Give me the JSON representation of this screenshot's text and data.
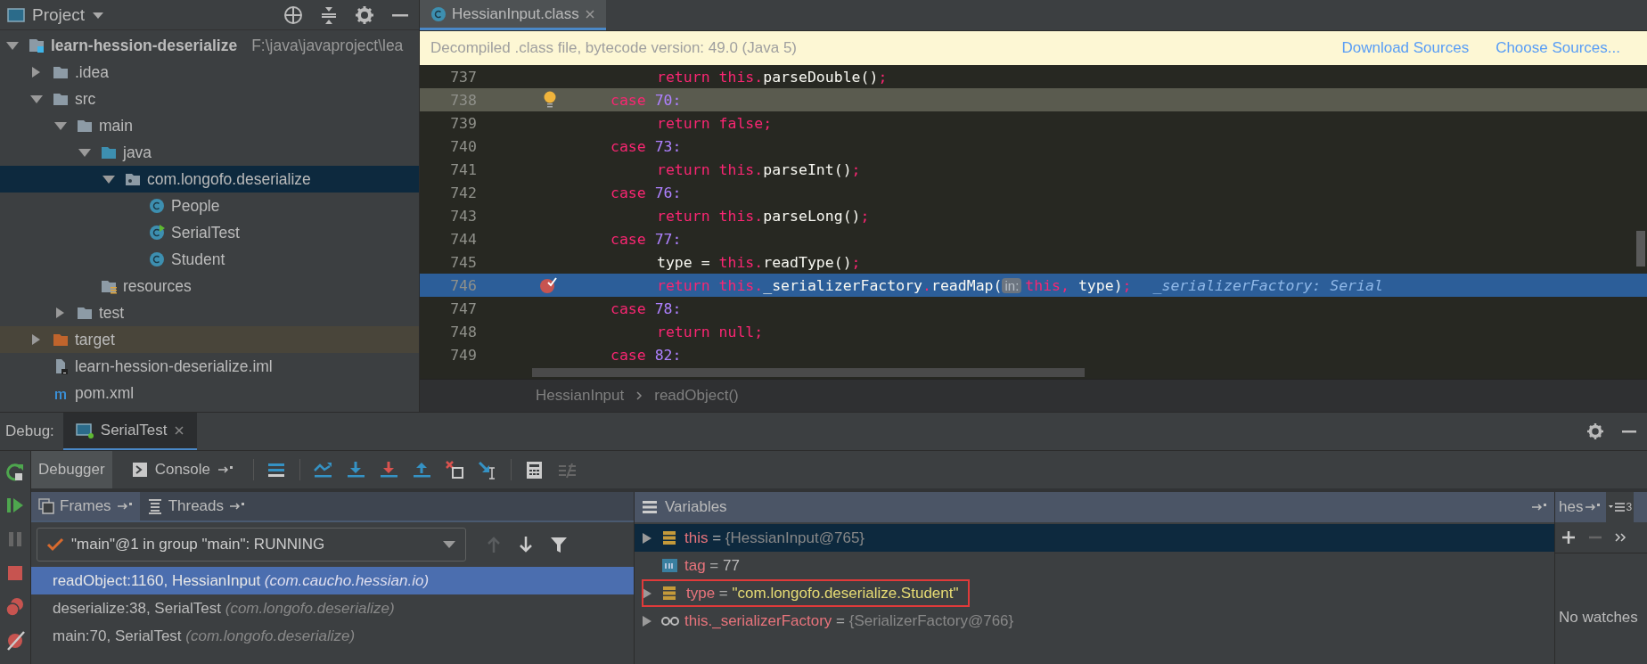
{
  "project_panel": {
    "title": "Project",
    "tree": [
      {
        "name": "learn-hession-deserialize",
        "path": "F:\\java\\javaproject\\lea",
        "kind": "module",
        "expanded": true,
        "selected": false,
        "children": [
          {
            "name": ".idea",
            "kind": "folder",
            "expanded": false,
            "selected": false
          },
          {
            "name": "src",
            "kind": "folder",
            "expanded": true,
            "selected": false,
            "children": [
              {
                "name": "main",
                "kind": "folder",
                "expanded": true,
                "selected": false,
                "children": [
                  {
                    "name": "java",
                    "kind": "source",
                    "expanded": true,
                    "selected": false,
                    "children": [
                      {
                        "name": "com.longofo.deserialize",
                        "kind": "package",
                        "expanded": true,
                        "selected": true,
                        "children": [
                          {
                            "name": "People",
                            "kind": "class",
                            "selected": false
                          },
                          {
                            "name": "SerialTest",
                            "kind": "runnable",
                            "selected": false
                          },
                          {
                            "name": "Student",
                            "kind": "class",
                            "selected": false
                          }
                        ]
                      }
                    ]
                  },
                  {
                    "name": "resources",
                    "kind": "resources",
                    "selected": false
                  }
                ]
              },
              {
                "name": "test",
                "kind": "folder",
                "expanded": false,
                "selected": false
              }
            ]
          },
          {
            "name": "target",
            "kind": "excluded",
            "expanded": false,
            "selected": false
          },
          {
            "name": "learn-hession-deserialize.iml",
            "kind": "iml",
            "selected": false
          },
          {
            "name": "pom.xml",
            "kind": "maven",
            "selected": false
          }
        ]
      }
    ]
  },
  "editor": {
    "tabs": [
      {
        "label": "HessianInput.class",
        "selected": true
      }
    ],
    "notice": {
      "text": "Decompiled .class file, bytecode version: 49.0 (Java 5)",
      "links": [
        "Download Sources",
        "Choose Sources..."
      ]
    },
    "lines": [
      {
        "number": "737",
        "kind": "stmt",
        "caret": false,
        "execution": false,
        "breakpoint": false,
        "tokens": [
          {
            "kind": "kw",
            "text": "return "
          },
          {
            "kind": "kw",
            "text": "this"
          },
          {
            "kind": "op",
            "text": "."
          },
          {
            "kind": "id",
            "text": "parseDouble()"
          },
          {
            "kind": "op",
            "text": ";"
          }
        ]
      },
      {
        "number": "738",
        "kind": "case",
        "caret": true,
        "execution": false,
        "breakpoint": false,
        "tokens": [
          {
            "kind": "kw",
            "text": "case "
          },
          {
            "kind": "num",
            "text": "70:"
          }
        ]
      },
      {
        "number": "739",
        "kind": "stmt",
        "caret": false,
        "execution": false,
        "breakpoint": false,
        "tokens": [
          {
            "kind": "kw",
            "text": "return false"
          },
          {
            "kind": "op",
            "text": ";"
          }
        ]
      },
      {
        "number": "740",
        "kind": "case",
        "caret": false,
        "execution": false,
        "breakpoint": false,
        "tokens": [
          {
            "kind": "kw",
            "text": "case "
          },
          {
            "kind": "num",
            "text": "73:"
          }
        ]
      },
      {
        "number": "741",
        "kind": "stmt",
        "caret": false,
        "execution": false,
        "breakpoint": false,
        "tokens": [
          {
            "kind": "kw",
            "text": "return "
          },
          {
            "kind": "kw",
            "text": "this"
          },
          {
            "kind": "op",
            "text": "."
          },
          {
            "kind": "id",
            "text": "parseInt()"
          },
          {
            "kind": "op",
            "text": ";"
          }
        ]
      },
      {
        "number": "742",
        "kind": "case",
        "caret": false,
        "execution": false,
        "breakpoint": false,
        "tokens": [
          {
            "kind": "kw",
            "text": "case "
          },
          {
            "kind": "num",
            "text": "76:"
          }
        ]
      },
      {
        "number": "743",
        "kind": "stmt",
        "caret": false,
        "execution": false,
        "breakpoint": false,
        "tokens": [
          {
            "kind": "kw",
            "text": "return "
          },
          {
            "kind": "kw",
            "text": "this"
          },
          {
            "kind": "op",
            "text": "."
          },
          {
            "kind": "id",
            "text": "parseLong()"
          },
          {
            "kind": "op",
            "text": ";"
          }
        ]
      },
      {
        "number": "744",
        "kind": "case",
        "caret": false,
        "execution": false,
        "breakpoint": false,
        "tokens": [
          {
            "kind": "kw",
            "text": "case "
          },
          {
            "kind": "num",
            "text": "77:"
          }
        ]
      },
      {
        "number": "745",
        "kind": "stmt",
        "caret": false,
        "execution": false,
        "breakpoint": false,
        "tokens": [
          {
            "kind": "id",
            "text": "type = "
          },
          {
            "kind": "kw",
            "text": "this"
          },
          {
            "kind": "op",
            "text": "."
          },
          {
            "kind": "id",
            "text": "readType()"
          },
          {
            "kind": "op",
            "text": ";"
          }
        ]
      },
      {
        "number": "746",
        "kind": "stmt",
        "caret": false,
        "execution": true,
        "breakpoint": true,
        "tokens": [
          {
            "kind": "kw",
            "text": "return "
          },
          {
            "kind": "kw",
            "text": "this"
          },
          {
            "kind": "op",
            "text": "."
          },
          {
            "kind": "id",
            "text": "_serializerFactory"
          },
          {
            "kind": "op",
            "text": "."
          },
          {
            "kind": "id",
            "text": "readMap("
          },
          {
            "kind": "hint",
            "text": "in:"
          },
          {
            "kind": "kw",
            "text": "this"
          },
          {
            "kind": "op",
            "text": ", "
          },
          {
            "kind": "id",
            "text": "type)"
          },
          {
            "kind": "op",
            "text": ";"
          }
        ],
        "inline_value": "_serializerFactory: Serial"
      },
      {
        "number": "747",
        "kind": "case",
        "caret": false,
        "execution": false,
        "breakpoint": false,
        "tokens": [
          {
            "kind": "kw",
            "text": "case "
          },
          {
            "kind": "num",
            "text": "78:"
          }
        ]
      },
      {
        "number": "748",
        "kind": "stmt",
        "caret": false,
        "execution": false,
        "breakpoint": false,
        "tokens": [
          {
            "kind": "kw",
            "text": "return null"
          },
          {
            "kind": "op",
            "text": ";"
          }
        ]
      },
      {
        "number": "749",
        "kind": "case",
        "caret": false,
        "execution": false,
        "breakpoint": false,
        "tokens": [
          {
            "kind": "kw",
            "text": "case "
          },
          {
            "kind": "num",
            "text": "82:"
          }
        ]
      }
    ],
    "breadcrumbs": [
      "HessianInput",
      "readObject()"
    ]
  },
  "debug": {
    "label": "Debug:",
    "sessions": [
      {
        "label": "SerialTest",
        "selected": true
      }
    ],
    "tabs": [
      {
        "label": "Debugger",
        "kind": "debugger",
        "selected": true
      },
      {
        "label": "Console",
        "kind": "console",
        "selected": false
      }
    ],
    "frame_tabs": [
      {
        "label": "Frames",
        "kind": "frames",
        "selected": true
      },
      {
        "label": "Threads",
        "kind": "threads",
        "selected": false
      }
    ],
    "thread": "\"main\"@1 in group \"main\": RUNNING",
    "frames": [
      {
        "method": "readObject:1160, HessianInput",
        "package": "(com.caucho.hessian.io)",
        "selected": true
      },
      {
        "method": "deserialize:38, SerialTest",
        "package": "(com.longofo.deserialize)",
        "selected": false
      },
      {
        "method": "main:70, SerialTest",
        "package": "(com.longofo.deserialize)",
        "selected": false
      }
    ],
    "variables": {
      "title": "Variables",
      "items": [
        {
          "kind": "object",
          "name": "this",
          "sep": "=",
          "value": "{HessianInput@765}",
          "expandable": true,
          "selected": true,
          "highlighted": false
        },
        {
          "kind": "primitive",
          "name": "tag",
          "sep": "=",
          "value": "77",
          "expandable": false,
          "selected": false,
          "highlighted": false
        },
        {
          "kind": "string",
          "name": "type",
          "sep": "=",
          "value": "\"com.longofo.deserialize.Student\"",
          "expandable": true,
          "selected": false,
          "highlighted": true
        },
        {
          "kind": "watch",
          "name": "this._serializerFactory",
          "sep": "=",
          "value": "{SerializerFactory@766}",
          "expandable": true,
          "selected": false,
          "highlighted": false
        }
      ]
    },
    "watches": {
      "tab": "hes",
      "count": "3",
      "empty_text": "No watches"
    }
  }
}
